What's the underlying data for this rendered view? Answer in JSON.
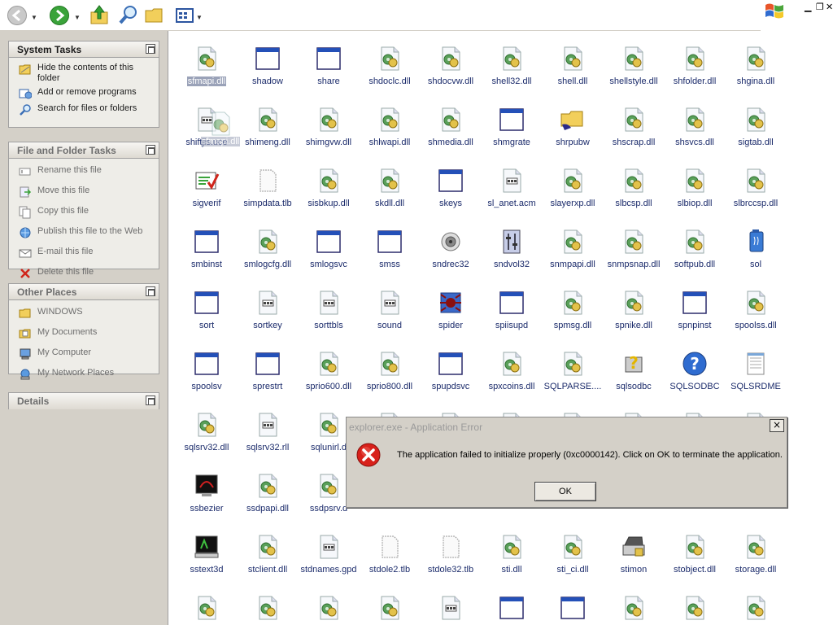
{
  "sidebar": {
    "system_tasks": {
      "title": "System Tasks",
      "items": [
        {
          "label": "Hide the contents of this folder",
          "icon": "hide-folder-icon"
        },
        {
          "label": "Add or remove programs",
          "icon": "add-remove-programs-icon"
        },
        {
          "label": "Search for files or folders",
          "icon": "search-icon"
        }
      ]
    },
    "file_folder_tasks": {
      "title": "File and Folder Tasks",
      "items": [
        {
          "label": "Rename this file",
          "icon": "rename-icon"
        },
        {
          "label": "Move this file",
          "icon": "move-icon"
        },
        {
          "label": "Copy this file",
          "icon": "copy-icon"
        },
        {
          "label": "Publish this file to the Web",
          "icon": "publish-web-icon"
        },
        {
          "label": "E-mail this file",
          "icon": "email-icon"
        },
        {
          "label": "Delete this file",
          "icon": "delete-icon"
        }
      ]
    },
    "other_places": {
      "title": "Other Places",
      "items": [
        {
          "label": "WINDOWS",
          "icon": "folder-icon"
        },
        {
          "label": "My Documents",
          "icon": "my-documents-icon"
        },
        {
          "label": "My Computer",
          "icon": "my-computer-icon"
        },
        {
          "label": "My Network Places",
          "icon": "network-places-icon"
        }
      ]
    },
    "details": {
      "title": "Details"
    }
  },
  "files": [
    {
      "name": "sfmapi.dll",
      "icon": "dll-icon",
      "selected": true
    },
    {
      "name": "shadow",
      "icon": "exe-window-icon"
    },
    {
      "name": "share",
      "icon": "exe-window-icon"
    },
    {
      "name": "shdoclc.dll",
      "icon": "dll-icon"
    },
    {
      "name": "shdocvw.dll",
      "icon": "dll-icon"
    },
    {
      "name": "shell32.dll",
      "icon": "dll-icon"
    },
    {
      "name": "shell.dll",
      "icon": "dll-icon"
    },
    {
      "name": "shellstyle.dll",
      "icon": "dll-icon"
    },
    {
      "name": "shfolder.dll",
      "icon": "dll-icon"
    },
    {
      "name": "shgina.dll",
      "icon": "dll-icon"
    },
    {
      "name": "shiftjis.uce",
      "icon": "text-file-icon"
    },
    {
      "name": "shimeng.dll",
      "icon": "dll-icon"
    },
    {
      "name": "shimgvw.dll",
      "icon": "dll-icon"
    },
    {
      "name": "shlwapi.dll",
      "icon": "dll-icon"
    },
    {
      "name": "shmedia.dll",
      "icon": "dll-icon"
    },
    {
      "name": "shmgrate",
      "icon": "exe-window-icon"
    },
    {
      "name": "shrpubw",
      "icon": "shared-folder-icon"
    },
    {
      "name": "shscrap.dll",
      "icon": "dll-icon"
    },
    {
      "name": "shsvcs.dll",
      "icon": "dll-icon"
    },
    {
      "name": "sigtab.dll",
      "icon": "dll-icon"
    },
    {
      "name": "sigverif",
      "icon": "sigverif-icon"
    },
    {
      "name": "simpdata.tlb",
      "icon": "generic-file-icon"
    },
    {
      "name": "sisbkup.dll",
      "icon": "dll-icon"
    },
    {
      "name": "skdll.dll",
      "icon": "dll-icon"
    },
    {
      "name": "skeys",
      "icon": "exe-window-icon"
    },
    {
      "name": "sl_anet.acm",
      "icon": "text-file-icon"
    },
    {
      "name": "slayerxp.dll",
      "icon": "dll-icon"
    },
    {
      "name": "slbcsp.dll",
      "icon": "dll-icon"
    },
    {
      "name": "slbiop.dll",
      "icon": "dll-icon"
    },
    {
      "name": "slbrccsp.dll",
      "icon": "dll-icon"
    },
    {
      "name": "smbinst",
      "icon": "exe-window-icon"
    },
    {
      "name": "smlogcfg.dll",
      "icon": "dll-icon"
    },
    {
      "name": "smlogsvc",
      "icon": "exe-window-icon"
    },
    {
      "name": "smss",
      "icon": "exe-window-icon"
    },
    {
      "name": "sndrec32",
      "icon": "speaker-icon"
    },
    {
      "name": "sndvol32",
      "icon": "volume-icon"
    },
    {
      "name": "snmpapi.dll",
      "icon": "dll-icon"
    },
    {
      "name": "snmpsnap.dll",
      "icon": "dll-icon"
    },
    {
      "name": "softpub.dll",
      "icon": "dll-icon"
    },
    {
      "name": "sol",
      "icon": "solitaire-icon"
    },
    {
      "name": "sort",
      "icon": "exe-window-icon"
    },
    {
      "name": "sortkey",
      "icon": "text-file-icon"
    },
    {
      "name": "sorttbls",
      "icon": "text-file-icon"
    },
    {
      "name": "sound",
      "icon": "text-file-icon"
    },
    {
      "name": "spider",
      "icon": "spider-icon"
    },
    {
      "name": "spiisupd",
      "icon": "exe-window-icon"
    },
    {
      "name": "spmsg.dll",
      "icon": "dll-icon"
    },
    {
      "name": "spnike.dll",
      "icon": "dll-icon"
    },
    {
      "name": "spnpinst",
      "icon": "exe-window-icon"
    },
    {
      "name": "spoolss.dll",
      "icon": "dll-icon"
    },
    {
      "name": "spoolsv",
      "icon": "exe-window-icon"
    },
    {
      "name": "sprestrt",
      "icon": "exe-window-icon"
    },
    {
      "name": "sprio600.dll",
      "icon": "dll-icon"
    },
    {
      "name": "sprio800.dll",
      "icon": "dll-icon"
    },
    {
      "name": "spupdsvc",
      "icon": "exe-window-icon"
    },
    {
      "name": "spxcoins.dll",
      "icon": "dll-icon"
    },
    {
      "name": "SQLPARSE....",
      "icon": "dll-icon"
    },
    {
      "name": "sqlsodbc",
      "icon": "help-file-icon"
    },
    {
      "name": "SQLSODBC",
      "icon": "help-circle-icon"
    },
    {
      "name": "SQLSRDME",
      "icon": "notepad-icon"
    },
    {
      "name": "sqlsrv32.dll",
      "icon": "dll-icon"
    },
    {
      "name": "sqlsrv32.rll",
      "icon": "text-file-icon"
    },
    {
      "name": "sqlunirl.d",
      "icon": "dll-icon"
    },
    {
      "name": "",
      "icon": "dll-icon"
    },
    {
      "name": "",
      "icon": "dll-icon"
    },
    {
      "name": "",
      "icon": "dll-icon"
    },
    {
      "name": "",
      "icon": "dll-icon"
    },
    {
      "name": "",
      "icon": "dll-icon"
    },
    {
      "name": "",
      "icon": "dll-icon"
    },
    {
      "name": "",
      "icon": "dll-icon"
    },
    {
      "name": "ssbezier",
      "icon": "screensaver-icon"
    },
    {
      "name": "ssdpapi.dll",
      "icon": "dll-icon"
    },
    {
      "name": "ssdpsrv.d",
      "icon": "dll-icon"
    },
    {
      "name": "",
      "icon": ""
    },
    {
      "name": "",
      "icon": ""
    },
    {
      "name": "",
      "icon": ""
    },
    {
      "name": "",
      "icon": ""
    },
    {
      "name": "",
      "icon": ""
    },
    {
      "name": "",
      "icon": ""
    },
    {
      "name": "",
      "icon": ""
    },
    {
      "name": "sstext3d",
      "icon": "screensaver-3d-icon"
    },
    {
      "name": "stclient.dll",
      "icon": "dll-icon"
    },
    {
      "name": "stdnames.gpd",
      "icon": "text-file-icon"
    },
    {
      "name": "stdole2.tlb",
      "icon": "generic-file-icon"
    },
    {
      "name": "stdole32.tlb",
      "icon": "generic-file-icon"
    },
    {
      "name": "sti.dll",
      "icon": "dll-icon"
    },
    {
      "name": "sti_ci.dll",
      "icon": "dll-icon"
    },
    {
      "name": "stimon",
      "icon": "scanner-icon"
    },
    {
      "name": "stobject.dll",
      "icon": "dll-icon"
    },
    {
      "name": "storage.dll",
      "icon": "dll-icon"
    },
    {
      "name": "",
      "icon": "dll-icon"
    },
    {
      "name": "",
      "icon": "dll-icon"
    },
    {
      "name": "",
      "icon": "dll-icon"
    },
    {
      "name": "",
      "icon": "dll-icon"
    },
    {
      "name": "",
      "icon": "text-file-icon"
    },
    {
      "name": "",
      "icon": "exe-window-icon"
    },
    {
      "name": "",
      "icon": "exe-window-icon"
    },
    {
      "name": "",
      "icon": "dll-icon"
    },
    {
      "name": "",
      "icon": "dll-icon"
    },
    {
      "name": "",
      "icon": "dll-icon"
    }
  ],
  "drag_ghost": {
    "name": "sfmapi.dll"
  },
  "dialog": {
    "title": "explorer.exe - Application Error",
    "message": "The application failed to initialize properly (0xc0000142). Click on OK to terminate the application.",
    "ok_label": "OK",
    "close_label": "×"
  },
  "colors": {
    "selection": "#9aa2b8",
    "file_label": "#1b2b6b",
    "panel_bg": "#eeede8",
    "pane_bg": "#d4d0c8"
  }
}
